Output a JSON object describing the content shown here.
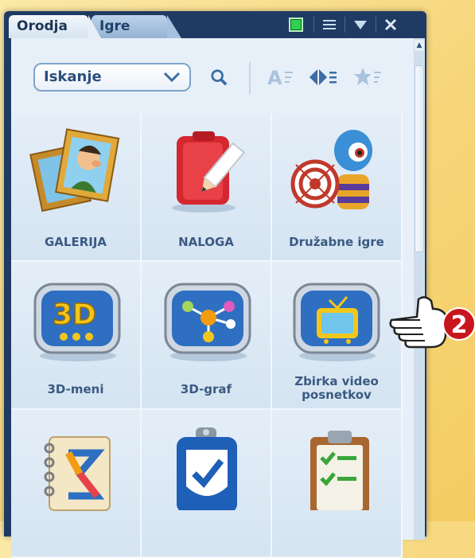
{
  "tabs": [
    {
      "label": "Orodja",
      "active": true
    },
    {
      "label": "Igre",
      "active": false
    }
  ],
  "toolbar": {
    "search_label": "Iskanje"
  },
  "items": [
    {
      "label": "GALERIJA",
      "icon": "gallery-portrait-icon"
    },
    {
      "label": "NALOGA",
      "icon": "task-pencil-icon"
    },
    {
      "label": "Družabne igre",
      "icon": "social-games-target-icon"
    },
    {
      "label": "3D-meni",
      "icon": "3d-menu-icon"
    },
    {
      "label": "3D-graf",
      "icon": "3d-graph-icon"
    },
    {
      "label": "Zbirka video posnetkov",
      "label_line1": "Zbirka video",
      "label_line2": "posnetkov",
      "icon": "video-tv-icon"
    },
    {
      "label": "",
      "icon": "sigma-notebook-icon"
    },
    {
      "label": "",
      "icon": "checkmark-shield-icon"
    },
    {
      "label": "",
      "icon": "checklist-clipboard-icon"
    }
  ],
  "callout": {
    "number": "2"
  },
  "colors": {
    "panel": "#1f3b64",
    "content": "#e7f0f8",
    "label": "#3a5a82",
    "callout": "#c8161d"
  }
}
